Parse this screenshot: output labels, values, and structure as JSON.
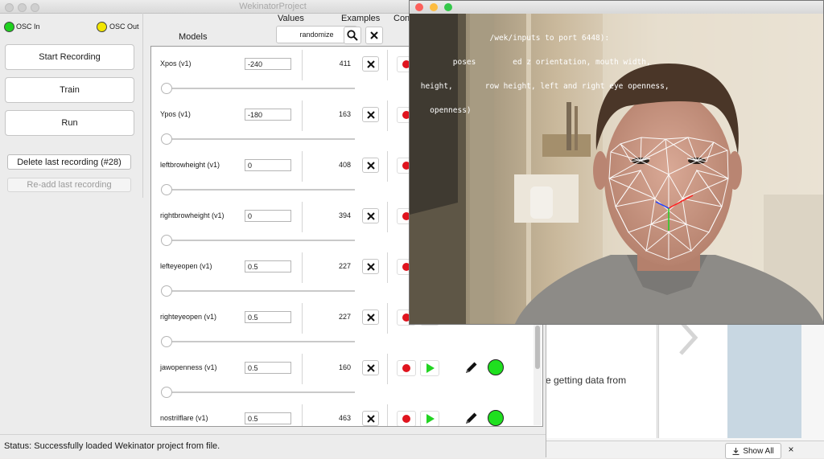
{
  "main_window": {
    "title": "WekinatorProject",
    "osc_in_label": "OSC In",
    "osc_out_label": "OSC Out",
    "osc_in_color": "#1fd11f",
    "osc_out_color": "#f2e600",
    "buttons": {
      "start_recording": "Start Recording",
      "train": "Train",
      "run": "Run",
      "delete_last": "Delete last recording (#28)",
      "readd_last": "Re-add last recording"
    },
    "headers": {
      "models": "Models",
      "values": "Values",
      "examples": "Examples",
      "config_partial": "Con"
    },
    "randomize_label": "randomize",
    "models": [
      {
        "name": "Xpos (v1)",
        "value": "-240",
        "examples": "411",
        "slider_fraction": 0.0
      },
      {
        "name": "Ypos (v1)",
        "value": "-180",
        "examples": "163",
        "slider_fraction": 0.0
      },
      {
        "name": "leftbrowheight (v1)",
        "value": "0",
        "examples": "408",
        "slider_fraction": 0.0
      },
      {
        "name": "rightbrowheight (v1)",
        "value": "0",
        "examples": "394",
        "slider_fraction": 0.0
      },
      {
        "name": "lefteyeopen (v1)",
        "value": "0.5",
        "examples": "227",
        "slider_fraction": 0.0
      },
      {
        "name": "righteyeopen (v1)",
        "value": "0.5",
        "examples": "227",
        "slider_fraction": 0.0
      },
      {
        "name": "jawopenness (v1)",
        "value": "0.5",
        "examples": "160",
        "slider_fraction": 0.0
      },
      {
        "name": "nostrilflare (v1)",
        "value": "0.5",
        "examples": "463",
        "slider_fraction": 0.0
      }
    ],
    "status": "Status:  Successfully loaded Wekinator project from file."
  },
  "camera_window": {
    "overlay_lines": [
      "                /wek/inputs to port 6448):",
      "        poses        ed z orientation, mouth width,",
      " height,       row height, left and right eye openness,",
      "   openness)"
    ]
  },
  "background_browser": {
    "partial_text": "e getting data from",
    "show_all": "Show All",
    "close_glyph": "×"
  }
}
